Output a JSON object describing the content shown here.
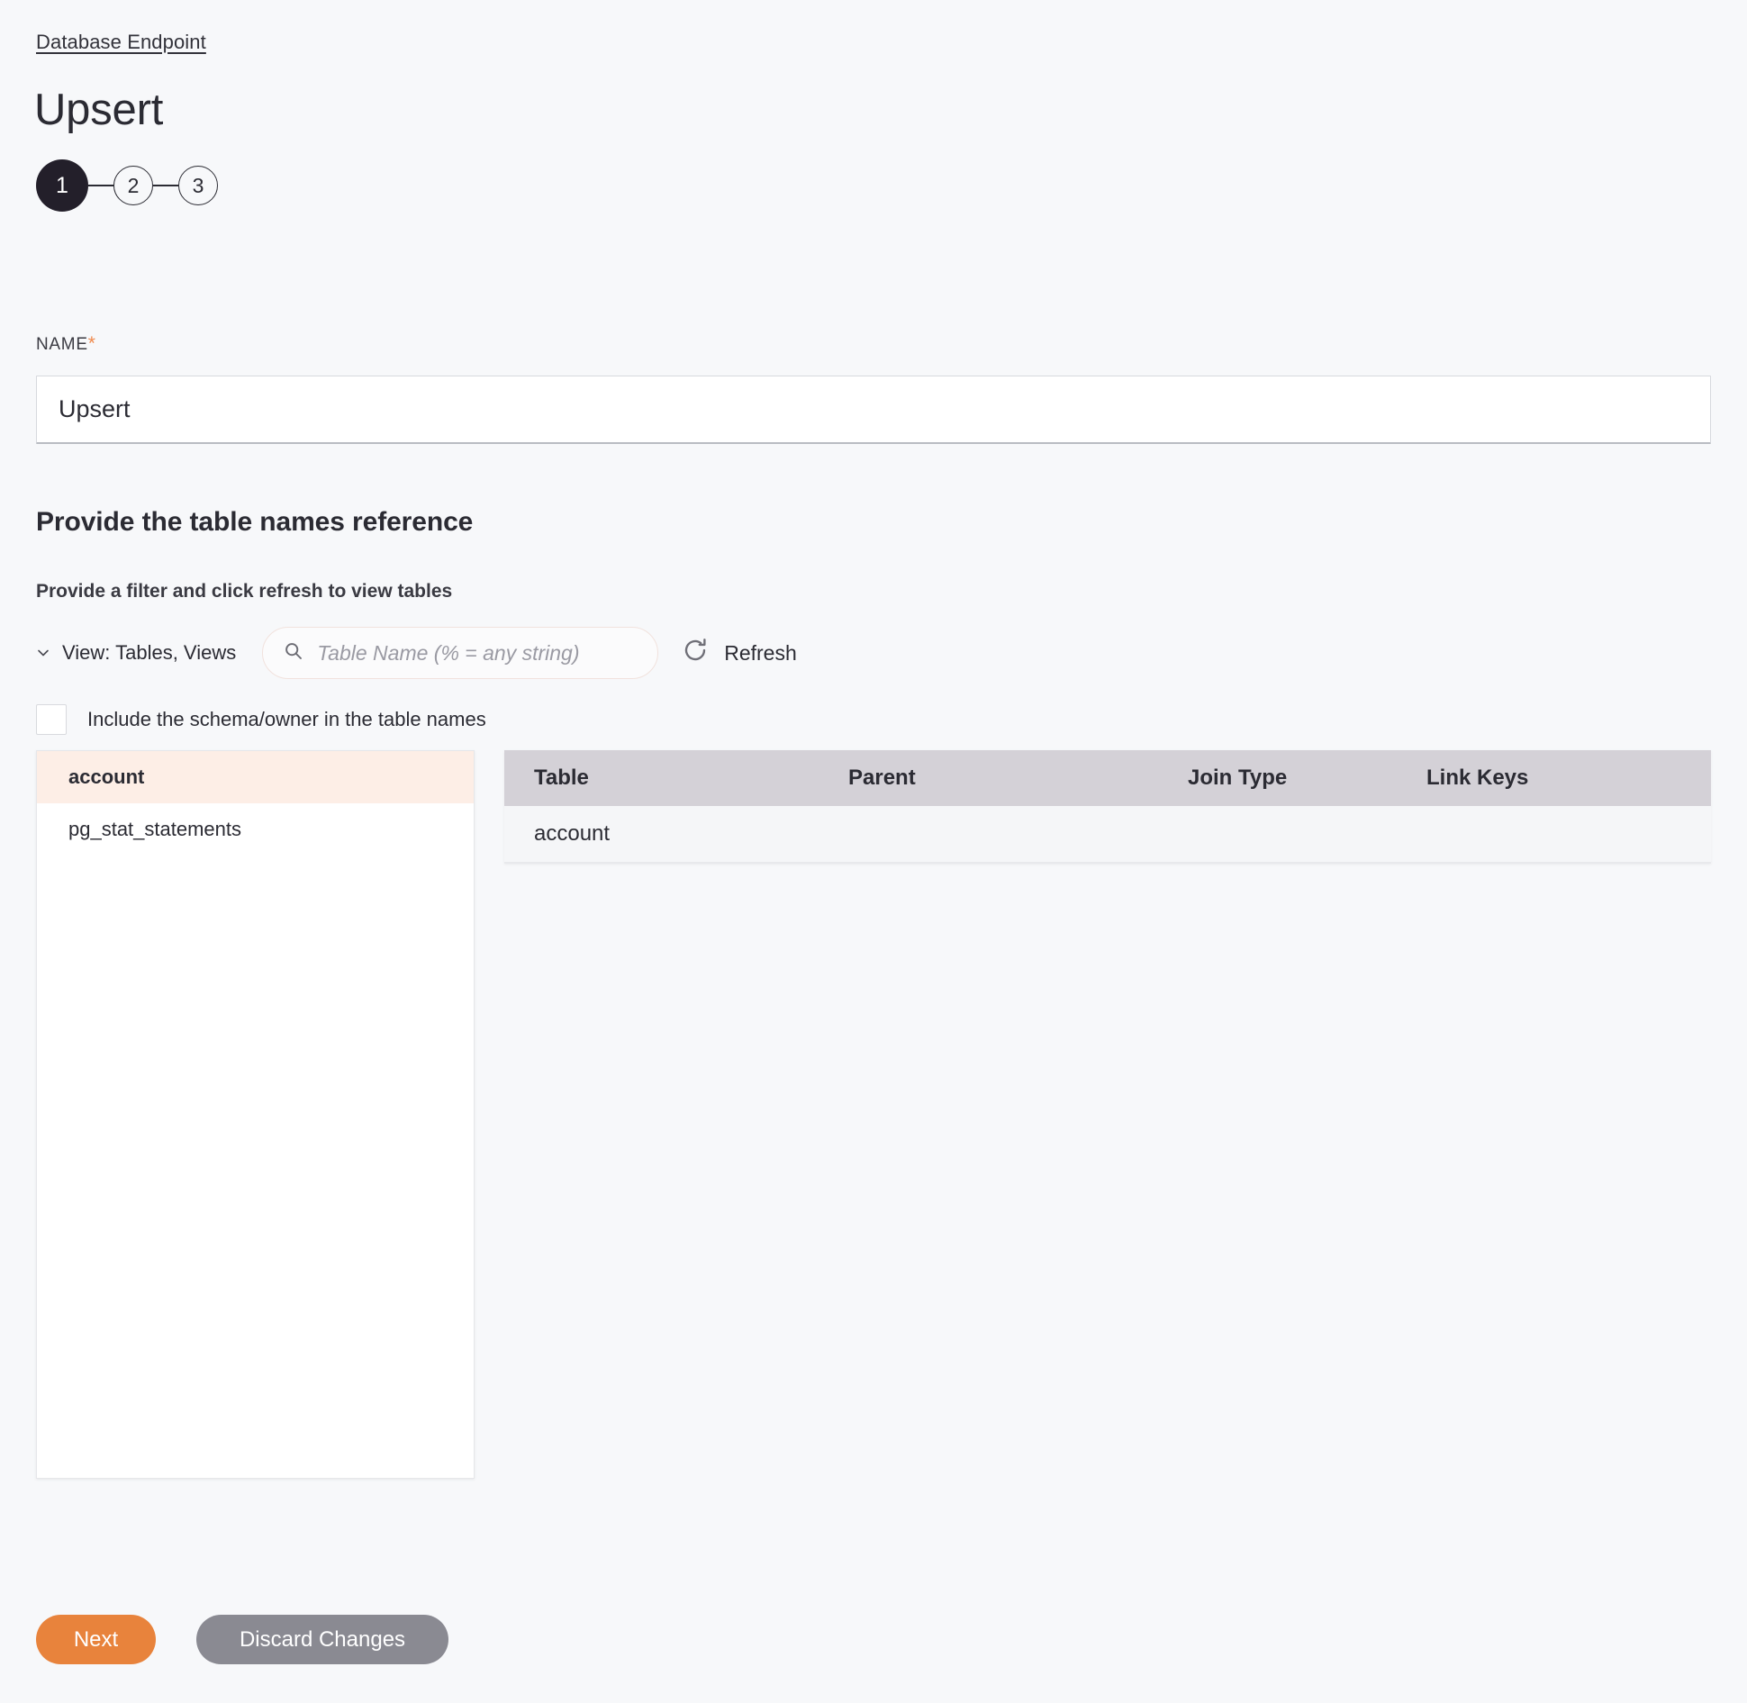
{
  "breadcrumb": {
    "label": "Database Endpoint"
  },
  "page": {
    "title": "Upsert"
  },
  "stepper": {
    "steps": [
      {
        "label": "1",
        "state": "active"
      },
      {
        "label": "2",
        "state": "inactive"
      },
      {
        "label": "3",
        "state": "inactive"
      }
    ]
  },
  "name_field": {
    "label": "NAME",
    "required_marker": "*",
    "value": "Upsert",
    "placeholder": ""
  },
  "section": {
    "title": "Provide the table names reference",
    "subtitle": "Provide a filter and click refresh to view tables"
  },
  "filter": {
    "view_select_label": "View: Tables, Views",
    "view_select_icon": "chevron-down-icon",
    "search_icon": "search-icon",
    "search_value": "",
    "search_placeholder": "Table Name (% = any string)",
    "refresh_icon": "refresh-icon",
    "refresh_label": "Refresh"
  },
  "schema_checkbox": {
    "label": "Include the schema/owner in the table names",
    "checked": false
  },
  "table_list": {
    "items": [
      {
        "label": "account",
        "selected": true
      },
      {
        "label": "pg_stat_statements",
        "selected": false
      }
    ]
  },
  "grid": {
    "columns": [
      "Table",
      "Parent",
      "Join Type",
      "Link Keys"
    ],
    "rows": [
      {
        "table": "account",
        "parent": "",
        "join_type": "",
        "link_keys": ""
      }
    ]
  },
  "footer": {
    "next_label": "Next",
    "discard_label": "Discard Changes"
  },
  "colors": {
    "accent_orange": "#e8833c",
    "required_star": "#f08a4e",
    "selected_row": "#fdeee6",
    "grid_header": "#d4d1d7",
    "grid_row": "#f5f6f8",
    "discard_gray": "#8a8a92",
    "step_active": "#231f2a",
    "page_bg": "#f7f8fa"
  }
}
